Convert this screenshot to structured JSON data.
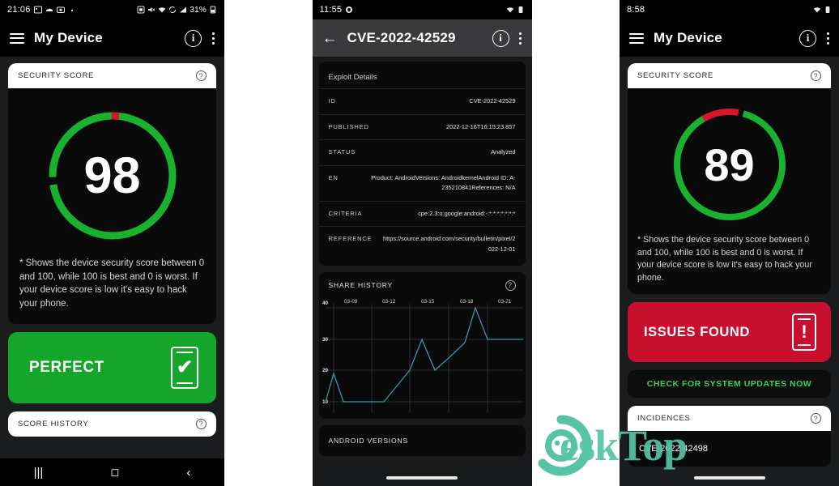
{
  "colors": {
    "green": "#19b22e",
    "green_btn": "#14a52a",
    "red": "#d6162a",
    "red_btn": "#c8102e",
    "accent_green_text": "#3ecf5a",
    "chart_line": "#3f93a8",
    "watermark": "#57c3a5",
    "app_bg": "#1b1c1e",
    "card_bg": "#0a0a0a"
  },
  "panel1": {
    "status": {
      "time": "21:06",
      "battery": "31%",
      "icons": [
        "alarm-icon",
        "image-icon",
        "cloud-icon",
        "camera-icon",
        "dot-icon",
        "sd-icon",
        "mute-icon",
        "wifi-icon",
        "signal-icon",
        "battery-icon"
      ]
    },
    "appbar": {
      "title": "My Device",
      "menu_icon": "hamburger-icon",
      "info_icon": "info-icon",
      "overflow_icon": "kebab-icon"
    },
    "security_card": {
      "header": "SECURITY SCORE",
      "help_icon": "help-icon",
      "score": "98",
      "score_value": 98
    },
    "note": "* Shows the device security score between 0 and 100, while 100 is best and 0 is worst. If your device score is low it's easy to hack your phone.",
    "status_button": {
      "label": "PERFECT",
      "icon": "phone-check-icon",
      "glyph": "✔"
    },
    "score_history": {
      "header": "SCORE HISTORY",
      "help_icon": "help-icon"
    },
    "nav": {
      "recents": "recents-icon",
      "home": "home-icon",
      "back": "back-icon"
    }
  },
  "panel2": {
    "status": {
      "time": "11:55",
      "icons": [
        "shield-icon",
        "wifi-icon",
        "battery-icon"
      ]
    },
    "appbar": {
      "title": "CVE-2022-42529",
      "back_icon": "back-arrow-icon",
      "info_icon": "info-icon",
      "overflow_icon": "kebab-icon"
    },
    "details": {
      "title": "Exploit Details",
      "rows": [
        {
          "key": "ID",
          "value": "CVE-2022-42529"
        },
        {
          "key": "PUBLISHED",
          "value": "2022-12-16T16:15:23.857"
        },
        {
          "key": "STATUS",
          "value": "Analyzed"
        },
        {
          "key": "EN",
          "value": "Product: AndroidVersions: AndroidkernelAndroid ID: A-235210841References: N/A"
        },
        {
          "key": "CRITERIA",
          "value": "cpe:2.3:o:google:android:-:*:*:*:*:*:*:*"
        },
        {
          "key": "REFERENCE",
          "value": "https://source.android.com/security/bulletin/pixel/2022-12-01"
        }
      ]
    },
    "share_history": {
      "header": "SHARE HISTORY",
      "help_icon": "help-icon"
    },
    "android_versions": {
      "header": "ANDROID VERSIONS"
    }
  },
  "panel3": {
    "status": {
      "time": "8:58",
      "icons": [
        "wifi-icon",
        "battery-icon"
      ]
    },
    "appbar": {
      "title": "My Device",
      "menu_icon": "hamburger-icon",
      "info_icon": "info-icon",
      "overflow_icon": "kebab-icon"
    },
    "security_card": {
      "header": "SECURITY SCORE",
      "help_icon": "help-icon",
      "score": "89",
      "score_value": 89
    },
    "note": "* Shows the device security score between 0 and 100, while 100 is best and 0 is worst. If your device score is low it's easy to hack your phone.",
    "status_button": {
      "label": "ISSUES FOUND",
      "icon": "phone-alert-icon",
      "glyph": "!"
    },
    "update_button": {
      "label": "CHECK FOR SYSTEM UPDATES NOW"
    },
    "incidences": {
      "header": "INCIDENCES",
      "help_icon": "help-icon",
      "items": [
        "CVE-2022-42498"
      ]
    }
  },
  "watermark": {
    "text": "eskTop",
    "logo_icon": "desktop-logo-icon"
  },
  "chart_data": {
    "type": "line",
    "title": "SHARE HISTORY",
    "x": [
      "03-07",
      "03-08",
      "03-09",
      "03-10",
      "03-11",
      "03-12",
      "03-13",
      "03-14",
      "03-15",
      "03-16",
      "03-17",
      "03-18",
      "03-19",
      "03-20",
      "03-21",
      "03-22"
    ],
    "tick_labels": [
      "03-09",
      "03-12",
      "03-15",
      "03-18",
      "03-21"
    ],
    "values": [
      10,
      19,
      10,
      10,
      10,
      10,
      20,
      29,
      20,
      25,
      30,
      40,
      29,
      29,
      29,
      29
    ],
    "ylabel": "",
    "xlabel": "",
    "ytick_labels": [
      "40",
      "30",
      "20",
      "10"
    ],
    "yticks": [
      40,
      30,
      20,
      10
    ],
    "ylim": [
      5,
      42
    ],
    "grid": true,
    "legend": "none",
    "series_color": "#3f93a8"
  }
}
